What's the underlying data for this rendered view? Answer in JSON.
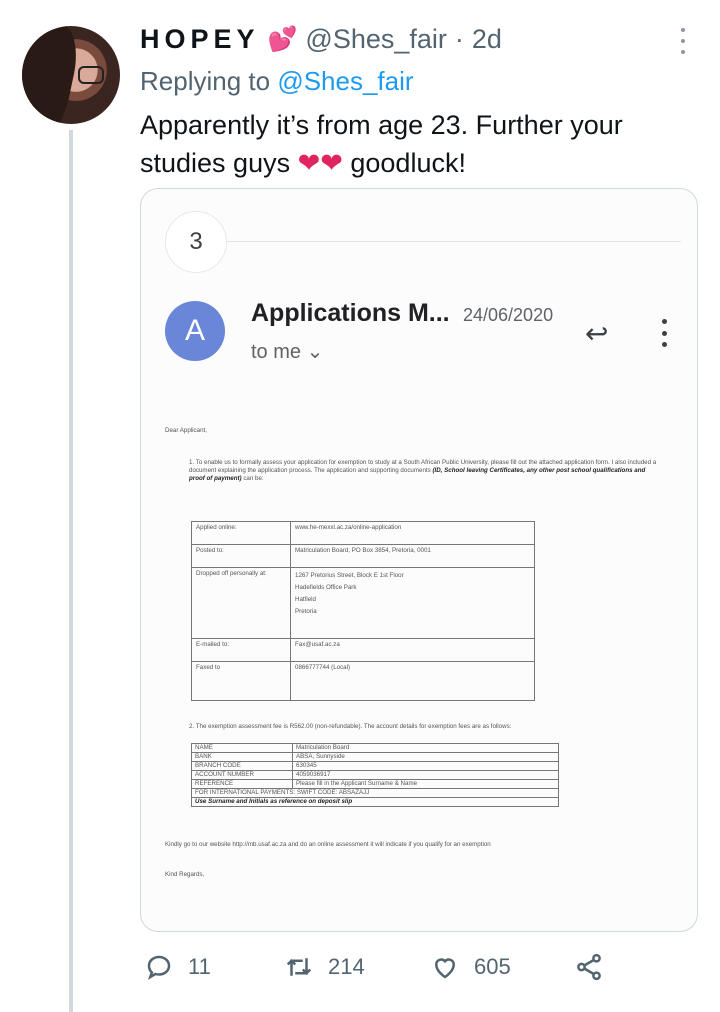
{
  "tweet": {
    "name": "HOPEY",
    "handle": "@Shes_fair",
    "dot": "·",
    "time": "2d",
    "replying_prefix": "Replying to",
    "replying_to": "@Shes_fair",
    "text_line1": "Apparently it’s from age 23. Further your",
    "text_line2_a": "studies guys",
    "hearts": "❤❤",
    "text_line2_b": "goodluck!"
  },
  "email": {
    "badge": "3",
    "sender_initial": "A",
    "subject": "Applications M...",
    "date": "24/06/2020",
    "to": "to me",
    "greeting": "Dear Applicant,",
    "para1_a": "1.  To enable us to formally assess your application for exemption to study at a South African Public University, please fill out the attached application form. I also included a document explaining the application process. The application and supporting documents",
    "para1_b": "(ID, School leaving Certificates, any other post school qualifications  and proof of payment)",
    "para1_c": "can be:",
    "table1": [
      {
        "label": "Applied online:",
        "value": "www.he-mexxl.ac.za/online-application"
      },
      {
        "label": "Posted to:",
        "value": "Matriculation Board, PO Box 3854, Pretoria, 0001"
      },
      {
        "label": "Dropped off personally at:",
        "value": "1267 Pretorius Street, Block E 1st Floor\nHadefields Office Park\nHatfield\nPretoria"
      },
      {
        "label": "E-mailed to:",
        "value": "Fax@usaf.ac.za"
      },
      {
        "label": "Faxed to",
        "value": "0866777744  (Local)"
      }
    ],
    "para2": "2.   The exemption assessment fee is R562.00 (non-refundable).  The account details for exemption fees are as follows:",
    "table2": [
      {
        "label": "NAME",
        "value": "Matriculation Board"
      },
      {
        "label": "BANK",
        "value": "ABSA, Sunnyside"
      },
      {
        "label": "BRANCH CODE",
        "value": "630345"
      },
      {
        "label": "ACCOUNT NUMBER",
        "value": "4059036917"
      },
      {
        "label": "REFERENCE",
        "value": "Please fill in the Applicant Surname & Name"
      }
    ],
    "intl": "FOR INTERNATIONAL PAYMENTS: SWIFT CODE: ABSAZAJJ",
    "deposit_note": "Use Surname and Initials as reference on deposit slip",
    "closing1": "Kindly go to our website http://mb.usaf.ac.za and do an online assessment it will indicate if you qualify for an exemption",
    "closing2": "Kind Regards,"
  },
  "actions": {
    "replies": "11",
    "retweets": "214",
    "likes": "605"
  },
  "colors": {
    "accent": "#1d9bf0",
    "heart": "#e0245e",
    "muted": "#536471",
    "sender_avatar": "#6a86d8"
  },
  "icons": [
    "reply-icon",
    "retweet-icon",
    "like-icon",
    "share-icon",
    "more-icon",
    "email-reply-icon",
    "chevron-down-icon"
  ]
}
